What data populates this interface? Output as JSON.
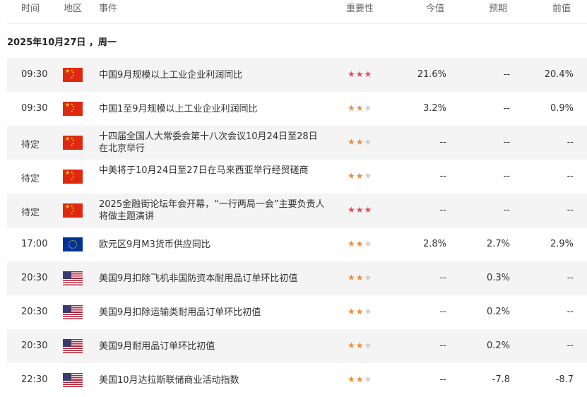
{
  "header": {
    "time": "时间",
    "region": "地区",
    "event": "事件",
    "importance": "重要性",
    "actual": "今值",
    "forecast": "预期",
    "previous": "前值"
  },
  "date_label": "2025年10月27日 ，周一",
  "colors": {
    "star_high": "#f0465a",
    "star_mid": "#f58a2e",
    "star_empty": "#cccccc",
    "row_shade": "#f4f4f4"
  },
  "events": [
    {
      "time": "09:30",
      "flag": "cn-flag-icon",
      "event": "中国9月规模以上工业企业利润同比",
      "stars": 3,
      "actual": "21.6%",
      "forecast": "--",
      "previous": "20.4%"
    },
    {
      "time": "09:30",
      "flag": "cn-flag-icon",
      "event": "中国1至9月规模以上工业企业利润同比",
      "stars": 2,
      "actual": "3.2%",
      "forecast": "--",
      "previous": "0.9%"
    },
    {
      "time": "待定",
      "flag": "cn-flag-icon",
      "event": "十四届全国人大常委会第十八次会议10月24日至28日在北京举行",
      "stars": 2,
      "actual": "--",
      "forecast": "--",
      "previous": "--"
    },
    {
      "time": "待定",
      "flag": "cn-flag-icon",
      "event": "中美将于10月24日至27日在马来西亚举行经贸磋商",
      "stars": 2,
      "actual": "--",
      "forecast": "--",
      "previous": "--"
    },
    {
      "time": "待定",
      "flag": "cn-flag-icon",
      "event": "2025金融街论坛年会开幕，“一行两局一会”主要负责人将做主题演讲",
      "stars": 3,
      "actual": "--",
      "forecast": "--",
      "previous": "--"
    },
    {
      "time": "17:00",
      "flag": "eu-flag-icon",
      "event": "欧元区9月M3货币供应同比",
      "stars": 2,
      "actual": "2.8%",
      "forecast": "2.7%",
      "previous": "2.9%"
    },
    {
      "time": "20:30",
      "flag": "us-flag-icon",
      "event": "美国9月扣除飞机非国防资本耐用品订单环比初值",
      "stars": 2,
      "actual": "--",
      "forecast": "0.3%",
      "previous": "--"
    },
    {
      "time": "20:30",
      "flag": "us-flag-icon",
      "event": "美国9月扣除运输类耐用品订单环比初值",
      "stars": 2,
      "actual": "--",
      "forecast": "0.2%",
      "previous": "--"
    },
    {
      "time": "20:30",
      "flag": "us-flag-icon",
      "event": "美国9月耐用品订单环比初值",
      "stars": 2,
      "actual": "--",
      "forecast": "0.2%",
      "previous": "--"
    },
    {
      "time": "22:30",
      "flag": "us-flag-icon",
      "event": "美国10月达拉斯联储商业活动指数",
      "stars": 2,
      "actual": "--",
      "forecast": "-7.8",
      "previous": "-8.7"
    }
  ]
}
